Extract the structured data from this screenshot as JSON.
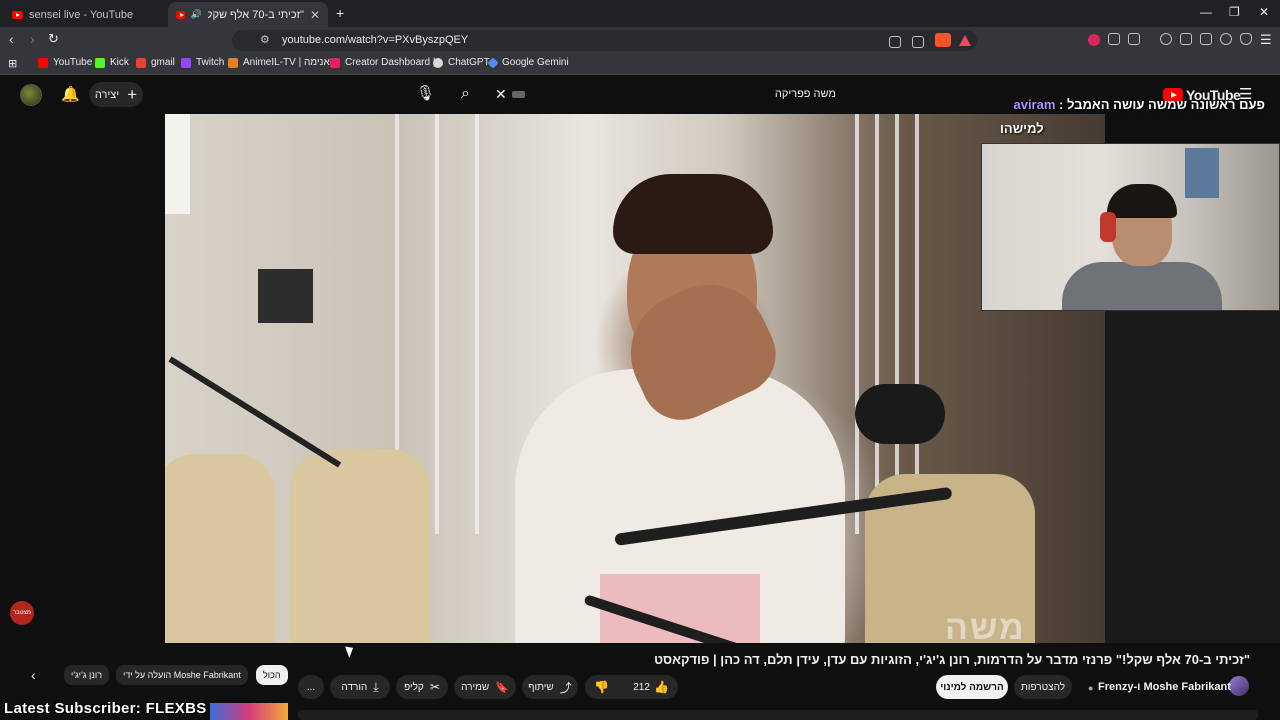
{
  "browser": {
    "tabs": [
      {
        "title": "sensei live - YouTube"
      },
      {
        "title": "\"זכיתי ב-70 אלף שקל!\" פרנזי"
      }
    ],
    "new_tab_symbol": "+",
    "url": "youtube.com/watch?v=PXvByszpQEY",
    "bookmarks": [
      {
        "label": "YouTube",
        "color": "#ff0000"
      },
      {
        "label": "Kick",
        "color": "#53fc18"
      },
      {
        "label": "gmail",
        "color": "#ea4335"
      },
      {
        "label": "Twitch",
        "color": "#9146ff"
      },
      {
        "label": "AnimeIL-TV | אנימה...",
        "color": "#e67e22"
      },
      {
        "label": "Creator Dashboard |...",
        "color": "#e91e63"
      },
      {
        "label": "ChatGPT",
        "color": "#d9d9d9"
      },
      {
        "label": "Google Gemini",
        "color": "#4e8cf7"
      }
    ]
  },
  "youtube": {
    "create_label": "יצירה",
    "search_query": "משה פפריקה",
    "logo_text": "YouTube"
  },
  "stream_overlay": {
    "title_prefix": "פעם ראשונה שמשה עושה האמבל :",
    "title_name": "aviram",
    "subtitle": "למישהו",
    "watermark": "משה",
    "live_badge": "מצטבר",
    "latest_subscriber": "Latest Subscriber: FLEXBS"
  },
  "video": {
    "title": "\"זכיתי ב-70 אלף שקל!\" פרנזי מדבר על הדרמות, רונן ג'יג'י, הזוגיות עם עדן, עידן תלם, דה כהן | פודקאסט",
    "channel": "Frenzy-ו Moshe Fabrikant",
    "join_label": "להצטרפות",
    "subscribe_label": "הרשמה למינוי",
    "likes": "212",
    "share_label": "שיתוף",
    "save_label": "שמירה",
    "clip_label": "קליפ",
    "download_label": "הורדה",
    "more_label": "..."
  },
  "chips": {
    "all": "הכול",
    "uploaded_by": "הועלה על ידי Moshe Fabrikant",
    "ronen": "רונן ג'יג'י"
  },
  "colors": {
    "bg": "#0f0f0f",
    "accent": "#ff0000",
    "overlay_name": "#b28cff"
  }
}
